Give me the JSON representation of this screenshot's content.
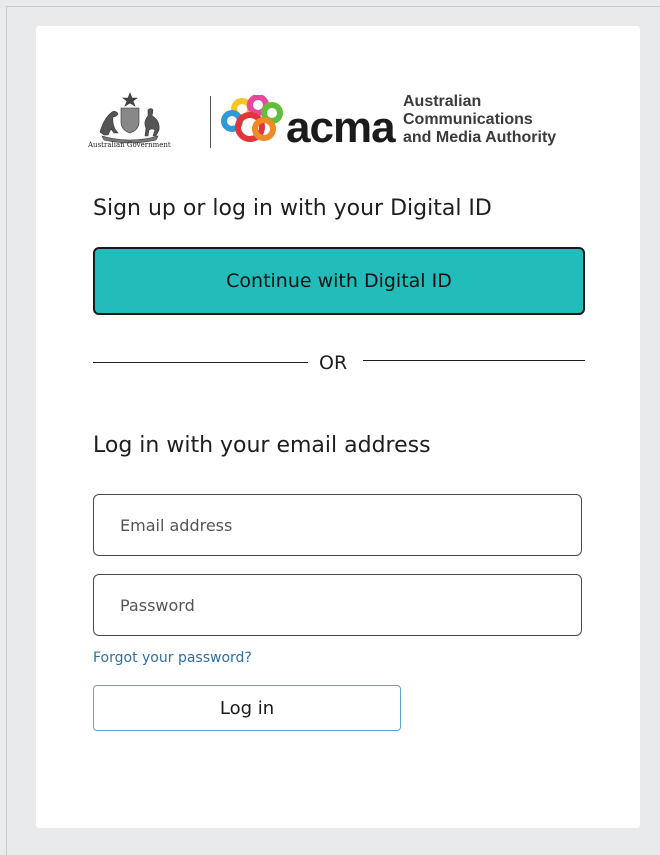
{
  "logos": {
    "government_text": "Australian Government",
    "acma_wordmark": "acma",
    "acma_full_name": [
      "Australian",
      "Communications",
      "and Media Authority"
    ]
  },
  "digital_id": {
    "heading": "Sign up or log in with your Digital ID",
    "button_label": "Continue with Digital ID"
  },
  "separator": {
    "label": "OR"
  },
  "email_login": {
    "heading": "Log in with your email address",
    "email_placeholder": "Email address",
    "password_placeholder": "Password",
    "forgot_link": "Forgot your password?",
    "login_button": "Log in"
  },
  "colors": {
    "digital_id_button": "#22bdbb",
    "link": "#2f6fa6",
    "page_background": "#e9eaeb",
    "acma_orange": "#f08a24",
    "acma_red": "#e2343b",
    "acma_pink": "#e8489a",
    "acma_yellow": "#f6c624",
    "acma_blue": "#2e9ad6",
    "acma_green": "#5fbf3b"
  }
}
